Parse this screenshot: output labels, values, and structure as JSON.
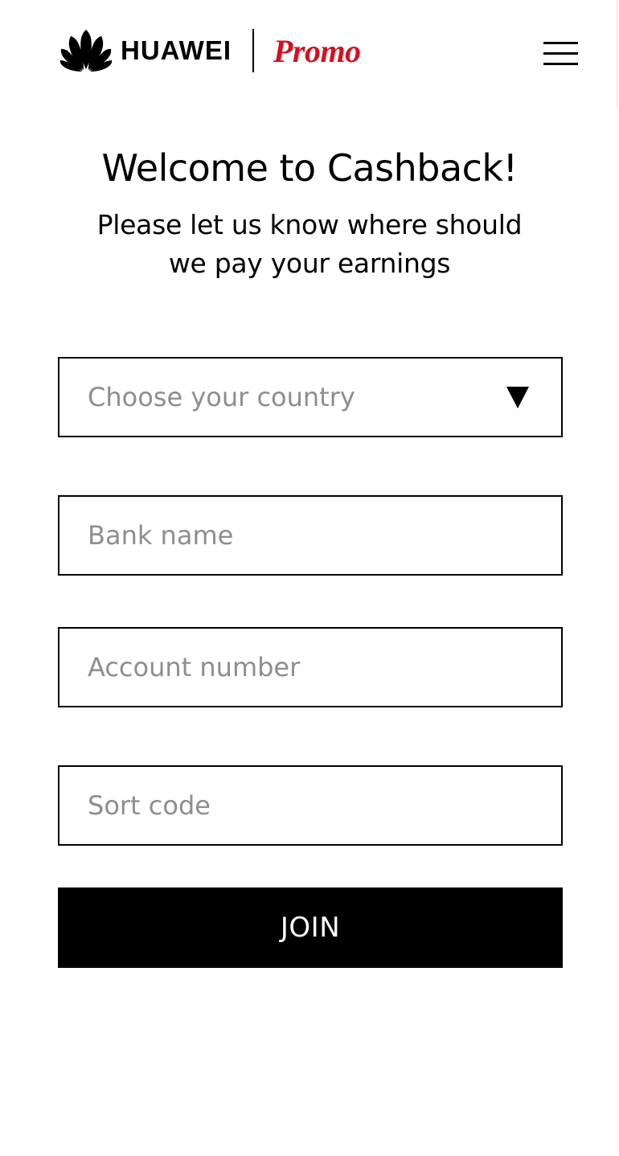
{
  "header": {
    "brand_name": "HUAWEI",
    "promo_label": "Promo",
    "logo_icon": "huawei-petal-logo-icon",
    "menu_icon": "hamburger-menu-icon"
  },
  "hero": {
    "title": "Welcome to Cashback!",
    "subtitle": "Please let us know where should we pay your earnings"
  },
  "form": {
    "country": {
      "placeholder": "Choose your country",
      "icon": "caret-down-icon"
    },
    "bank_name": {
      "placeholder": "Bank name",
      "value": ""
    },
    "account_number": {
      "placeholder": "Account number",
      "value": ""
    },
    "sort_code": {
      "placeholder": "Sort code",
      "value": ""
    },
    "submit_label": "JOIN"
  },
  "colors": {
    "brand_red": "#d60f20",
    "text": "#000000",
    "placeholder": "#8e8e8e",
    "button_background": "#000000",
    "button_text": "#ffffff",
    "field_border": "#000000"
  }
}
